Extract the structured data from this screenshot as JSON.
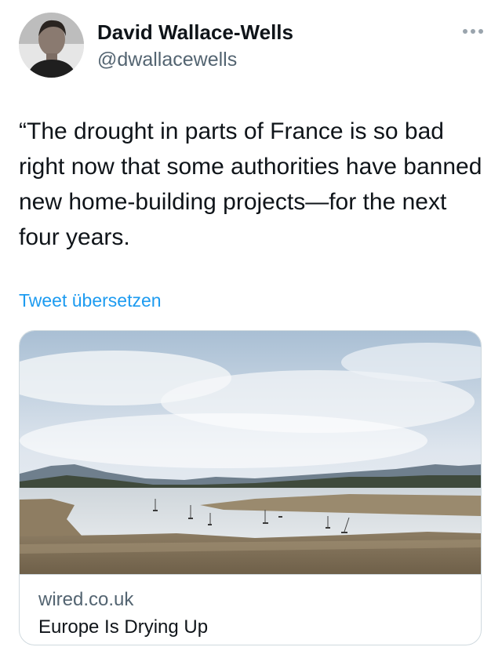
{
  "author": {
    "name": "David Wallace-Wells",
    "handle": "@dwallacewells"
  },
  "tweet": {
    "text": "“The drought in parts of France is so bad right now that some authorities have banned new home-building projects—for the next four years.",
    "translate_label": "Tweet übersetzen"
  },
  "link_card": {
    "domain": "wired.co.uk",
    "title": "Europe Is Drying Up"
  },
  "icons": {
    "more": "more-horizontal-icon"
  },
  "colors": {
    "text": "#0f1419",
    "secondary": "#536471",
    "link": "#1d9bf0",
    "border": "#cfd9de"
  }
}
